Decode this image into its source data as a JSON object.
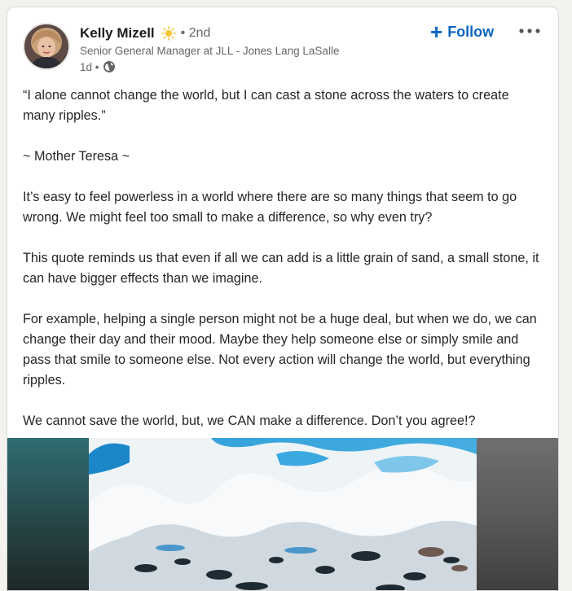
{
  "post": {
    "author": {
      "name": "Kelly Mizell",
      "badge_icon": "sun-icon",
      "connection_degree": "• 2nd",
      "headline": "Senior General Manager at JLL - Jones Lang LaSalle",
      "posted_time": "1d •",
      "visibility_icon": "globe-icon"
    },
    "actions": {
      "follow_label": "Follow",
      "follow_icon": "plus-icon",
      "more_icon": "ellipsis-icon"
    },
    "paragraphs": [
      "“I alone cannot change the world, but I can cast a stone across the waters to create many ripples.”",
      "~ Mother Teresa ~",
      "It’s easy to feel powerless in a world where there are so many things that seem to go wrong. We might feel too small to make a difference, so why even try?",
      "This quote reminds us that even if all we can add is a little grain of sand, a small stone, it can have bigger effects than we imagine.",
      "For example, helping a single person might not be a huge deal, but when we do, we can change their day and their mood. Maybe they help someone else or simply smile and pass that smile to someone else. Not every action will change the world, but everything ripples.",
      "We cannot save the world, but, we CAN make a difference. Don’t you agree!?"
    ]
  },
  "colors": {
    "accent": "#0a66c2",
    "text_primary": "#1d1d1d",
    "text_secondary": "#666666"
  }
}
